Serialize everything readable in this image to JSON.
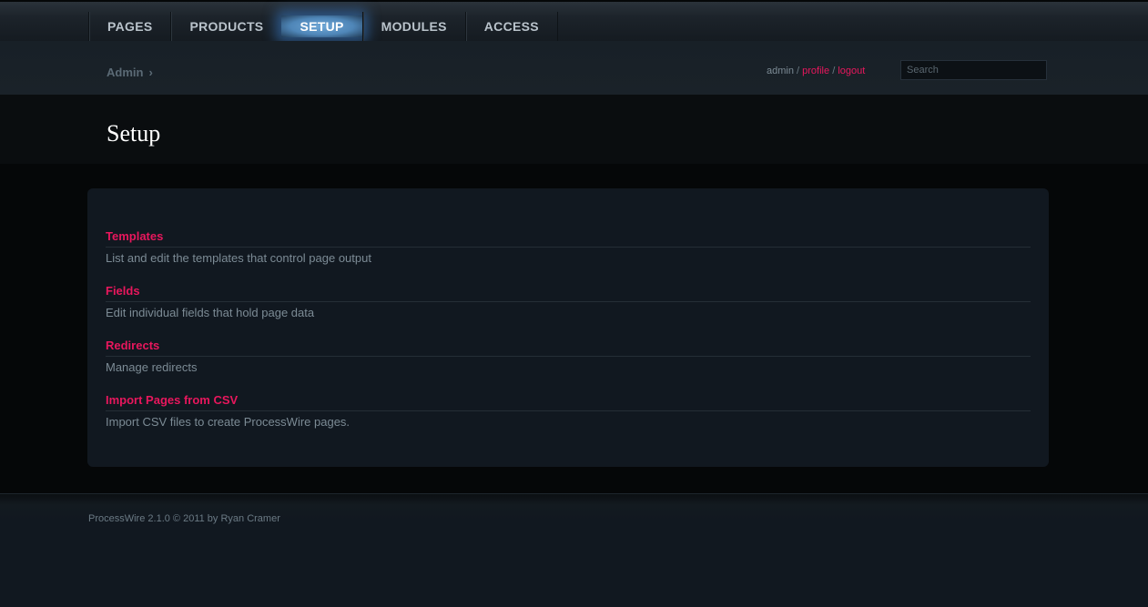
{
  "nav": {
    "tabs": [
      {
        "label": "Pages"
      },
      {
        "label": "Products"
      },
      {
        "label": "Setup"
      },
      {
        "label": "Modules"
      },
      {
        "label": "Access"
      }
    ],
    "active_tab": "Setup"
  },
  "breadcrumb": {
    "item": "Admin",
    "separator": "›"
  },
  "user": {
    "name": "admin",
    "profile": "profile",
    "logout": "logout",
    "divider": "/"
  },
  "search": {
    "placeholder": "Search",
    "value": ""
  },
  "page": {
    "title": "Setup"
  },
  "items": [
    {
      "title": "Templates",
      "description": "List and edit the templates that control page output"
    },
    {
      "title": "Fields",
      "description": "Edit individual fields that hold page data"
    },
    {
      "title": "Redirects",
      "description": "Manage redirects"
    },
    {
      "title": "Import Pages from CSV",
      "description": "Import CSV files to create ProcessWire pages."
    }
  ],
  "footer": {
    "credit": "ProcessWire 2.1.0 © 2011 by Ryan Cramer"
  },
  "colors": {
    "accent": "#e8175d",
    "active_tab_glow": "#4f86b8",
    "background": "#111820"
  }
}
